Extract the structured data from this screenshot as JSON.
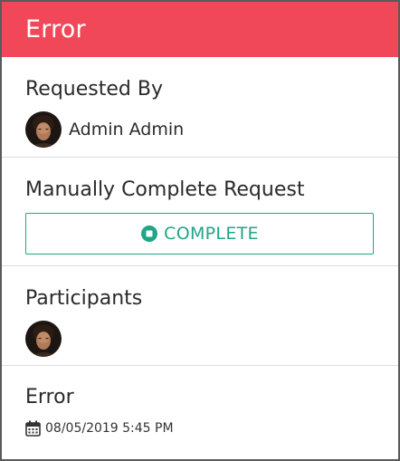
{
  "header": {
    "title": "Error",
    "background_color": "#f04858"
  },
  "requested_by": {
    "title": "Requested By",
    "user_name": "Admin Admin",
    "avatar_icon": "user-avatar"
  },
  "manual_complete": {
    "title": "Manually Complete Request",
    "button_label": "COMPLETE",
    "button_icon": "stop-circle-icon",
    "accent_color": "#20a588"
  },
  "participants": {
    "title": "Participants",
    "avatar_icon": "user-avatar"
  },
  "error": {
    "title": "Error",
    "date": "08/05/2019 5:45 PM",
    "date_icon": "calendar-icon"
  }
}
